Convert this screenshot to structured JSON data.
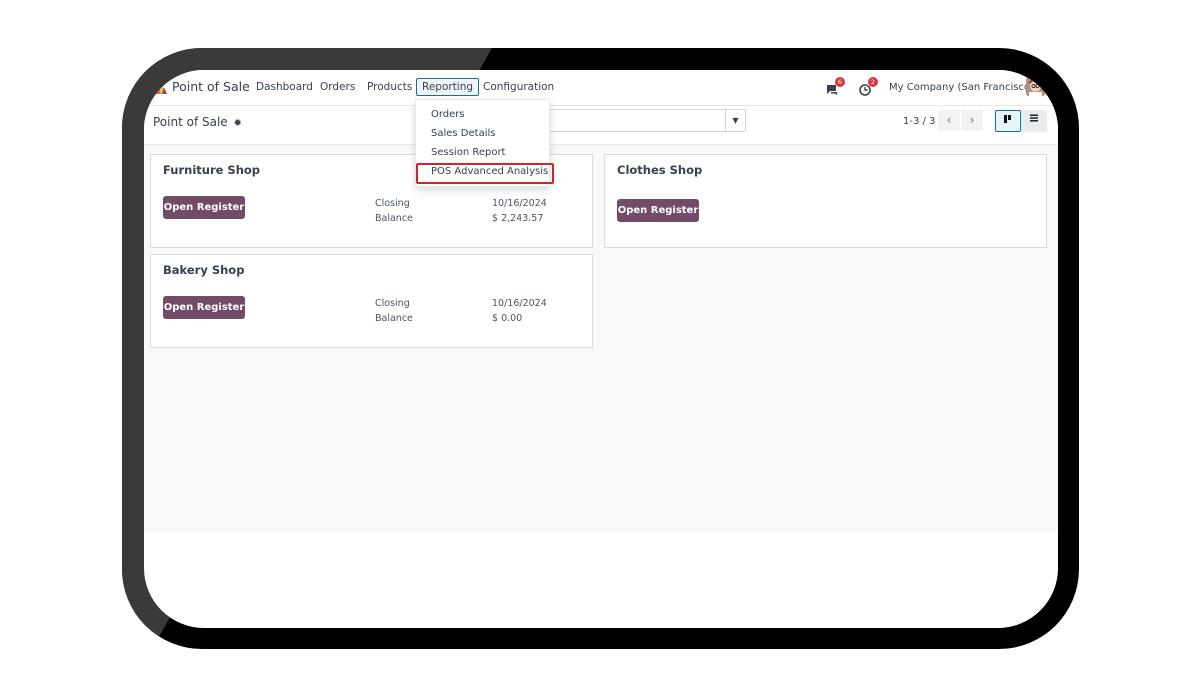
{
  "navbar": {
    "app_title": "Point of Sale",
    "menu": [
      "Dashboard",
      "Orders",
      "Products",
      "Reporting",
      "Configuration"
    ],
    "active_menu": "Reporting",
    "messages_count": "6",
    "activities_count": "2",
    "company": "My Company (San Francisco)"
  },
  "reporting_dropdown": {
    "items": [
      "Orders",
      "Sales Details",
      "Session Report",
      "POS Advanced Analysis"
    ],
    "highlighted": "POS Advanced Analysis"
  },
  "control_panel": {
    "breadcrumb": "Point of Sale",
    "pager": "1-3 / 3"
  },
  "cards": [
    {
      "title": "Furniture Shop",
      "button": "Open Register",
      "closing_label": "Closing",
      "closing_value": "10/16/2024",
      "balance_label": "Balance",
      "balance_value": "$ 2,243.57"
    },
    {
      "title": "Clothes Shop",
      "button": "Open Register"
    },
    {
      "title": "Bakery Shop",
      "button": "Open Register",
      "closing_label": "Closing",
      "closing_value": "10/16/2024",
      "balance_label": "Balance",
      "balance_value": "$ 0.00"
    }
  ],
  "colors": {
    "brand": "#714b67",
    "accent": "#0e7490",
    "badge": "#d9363e",
    "highlight_border": "#d1252a"
  }
}
